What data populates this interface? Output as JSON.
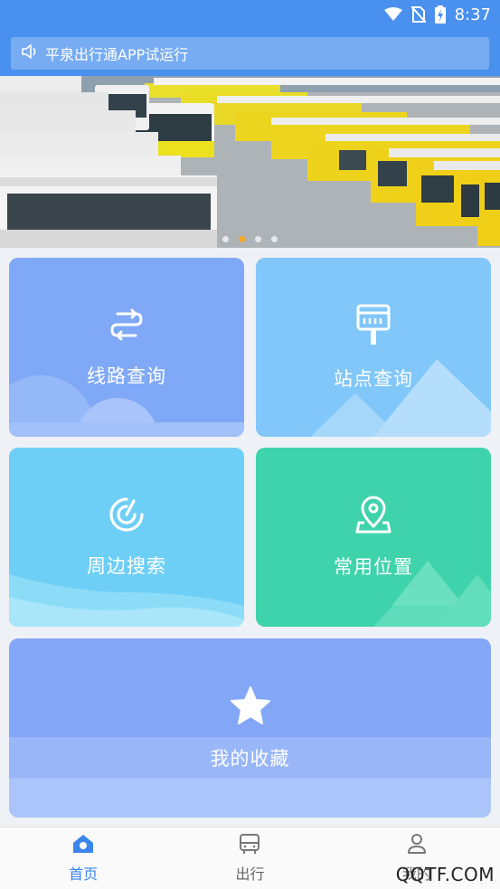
{
  "status_bar": {
    "time": "8:37",
    "icons": [
      "wifi-icon",
      "no-sim-icon",
      "battery-charging-icon"
    ]
  },
  "notice": {
    "icon": "speaker-icon",
    "text": "平泉出行通APP试运行"
  },
  "banner": {
    "slide_count": 4,
    "active_index": 1
  },
  "cards": {
    "route": {
      "label": "线路查询",
      "icon": "route-swap-icon"
    },
    "station": {
      "label": "站点查询",
      "icon": "bus-stop-sign-icon"
    },
    "nearby": {
      "label": "周边搜索",
      "icon": "radar-icon"
    },
    "common": {
      "label": "常用位置",
      "icon": "map-pin-icon"
    },
    "favorites": {
      "label": "我的收藏",
      "icon": "star-icon"
    }
  },
  "bottom_nav": {
    "items": [
      {
        "label": "首页",
        "icon": "home-icon",
        "active": true
      },
      {
        "label": "出行",
        "icon": "bus-icon",
        "active": false
      },
      {
        "label": "我的",
        "icon": "user-icon",
        "active": false
      }
    ]
  },
  "watermark": "QQTF.COM",
  "colors": {
    "primary": "#4a90ee",
    "active_nav": "#3a86ea",
    "dot_active": "#f5a623",
    "route_card": "#7fa8f6",
    "station_card": "#81c7f9",
    "nearby_card": "#6ecff6",
    "common_card": "#3fd3ac",
    "fav_card": "#83a6f7"
  }
}
